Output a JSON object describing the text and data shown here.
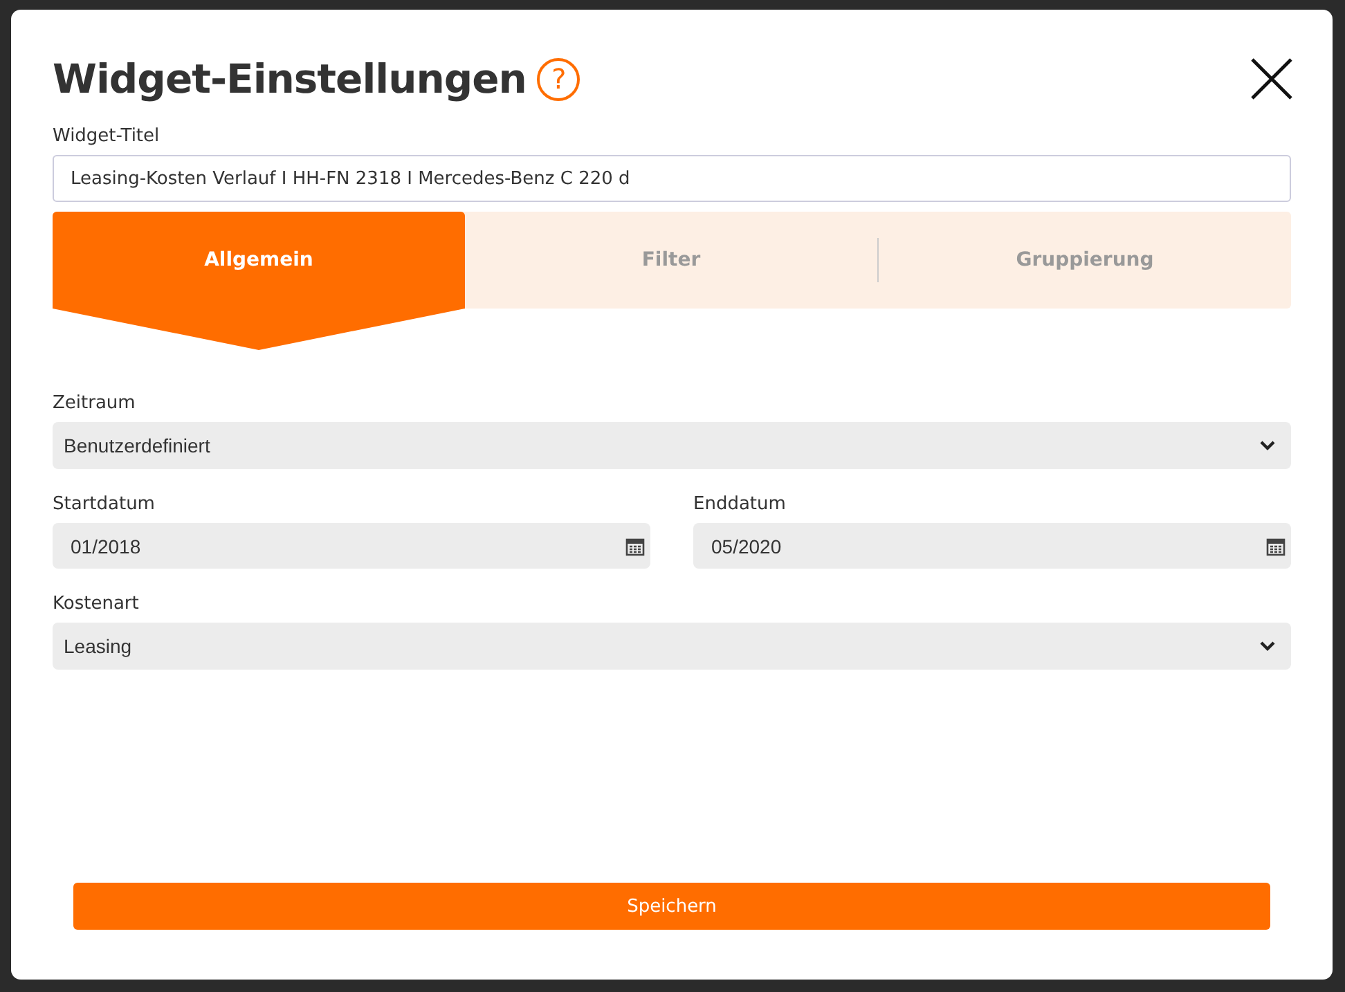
{
  "dialog": {
    "title": "Widget-Einstellungen",
    "help_icon": "?"
  },
  "widget_title": {
    "label": "Widget-Titel",
    "value": "Leasing-Kosten Verlauf I HH-FN 2318 I Mercedes-Benz C 220 d"
  },
  "tabs": [
    {
      "label": "Allgemein",
      "selected": true
    },
    {
      "label": "Filter",
      "selected": false
    },
    {
      "label": "Gruppierung",
      "selected": false
    }
  ],
  "fields": [
    {
      "kind": "select",
      "label": "Zeitraum",
      "value": "Benutzerdefiniert"
    },
    {
      "kind": "date_pair",
      "items": [
        {
          "label": "Startdatum",
          "value": "01/2018"
        },
        {
          "label": "Enddatum",
          "value": "05/2020"
        }
      ]
    },
    {
      "kind": "select",
      "label": "Kostenart",
      "value": "Leasing"
    }
  ],
  "save_button": "Speichern"
}
